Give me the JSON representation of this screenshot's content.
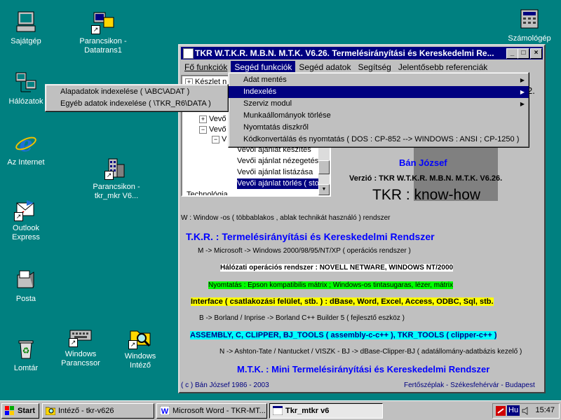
{
  "desktop": {
    "icons": [
      {
        "label": "Sajátgép"
      },
      {
        "label": "Parancsikon -\nDatatrans1"
      },
      {
        "label": "Számológép"
      },
      {
        "label": "Hálózatok"
      },
      {
        "label": "Az Internet"
      },
      {
        "label": "Parancsikon -\ntkr_mkr V6..."
      },
      {
        "label": "Outlook\nExpress"
      },
      {
        "label": "Posta"
      },
      {
        "label": "Lomtár"
      },
      {
        "label": "Windows\nParancssor"
      },
      {
        "label": "Windows\nIntéző"
      }
    ]
  },
  "window": {
    "title": "TKR W.T.K.R. M.B.N. M.T.K. V6.26.  Termelésirányítási és Kereskedelmi Re...",
    "controls": {
      "min": "_",
      "max": "□",
      "close": "×"
    },
    "menu": [
      "Fő funkciók",
      "Segéd funkciók",
      "Segéd adatok",
      "Segítség",
      "Jelentősebb referenciák"
    ],
    "tree": {
      "rows": [
        {
          "pm": "+",
          "label": "Készlet n"
        },
        {
          "pm": "",
          "label": "Vevő"
        },
        {
          "pm": "+",
          "label": "Vevő"
        },
        {
          "pm": "−",
          "label": "Vevő"
        },
        {
          "pm": "−",
          "label": "V"
        },
        {
          "pm": "",
          "label": "Vevői ajánlat készítés"
        },
        {
          "pm": "",
          "label": "Vevői ajánlat nézegetés,"
        },
        {
          "pm": "",
          "label": "Vevői ajánlat listázása"
        },
        {
          "pm": "",
          "label": "Vevői ajánlat törlés ( storn"
        },
        {
          "pm": "",
          "label": "Technológia"
        }
      ]
    },
    "partial_text_2": "2.",
    "author_name": "Bán József",
    "version": "Verzió :  TKR W.T.K.R. M.B.N. M.T.K. V6.26.",
    "big_title": "TKR :  know-how",
    "line_w": "W : Window -os ( többablakos , ablak technikát használó ) rendszer",
    "tkr_heading": "T.K.R. : Termelésirányítási és Kereskedelmi Rendszer",
    "line_m": "M -> Microsoft -> Windows 2000/98/95/NT/XP       ( operációs rendszer )",
    "network": "Hálózati operációs rendszer : NOVELL NETWARE, WINDOWS NT/2000",
    "printing": "Nyomtatás : Epson kompatibilis mátrix ;  Windows-os tintasugaras, lézer, mátrix",
    "interface": "Interface ( csatlakozási felület, stb. )  : dBase, Word, Excel, Access, ODBC, Sql, stb.",
    "line_b": "B -> Borland / Inprise -> Borland C++ Builder 5        ( fejlesztő eszköz )",
    "tools": "ASSEMBLY, C, CLIPPER, BJ_TOOLS ( assembly-c-c++ ), TKR_TOOLS ( clipper-c++ )",
    "line_n": "N -> Ashton-Tate / Nantucket / VISZK - BJ -> dBase-Clipper-BJ   ( adatállomány-adatbázis kezelő )",
    "mtk_heading": "M.T.K. : Mini Termelésirányítási és Kereskedelmi Rendszer",
    "footer_left": "( c ) Bán József 1986 - 2003",
    "footer_right": "Fertőszéplak - Székesfehérvár - Budapest"
  },
  "menus": {
    "seged": [
      {
        "label": "Adat mentés",
        "arrow": true
      },
      {
        "label": "Indexelés",
        "arrow": true,
        "highlighted": true
      },
      {
        "label": "Szerviz modul",
        "arrow": true
      },
      {
        "label": "Munkaállományok törlése",
        "arrow": false
      },
      {
        "label": "Nyomtatás diszkről",
        "arrow": false
      },
      {
        "label": "Kódkonvertálás és nyomtatás  ( DOS : CP-852 --> WINDOWS : ANSI ; CP-1250 )",
        "arrow": false
      }
    ],
    "indexeles": [
      {
        "label": "Alapadatok indexelése ( \\ABC\\ADAT )"
      },
      {
        "label": "Egyéb adatok indexelése ( \\TKR_R6\\DATA )"
      }
    ]
  },
  "taskbar": {
    "start": "Start",
    "buttons": [
      {
        "label": "Intéző - tkr-v626"
      },
      {
        "label": "Microsoft Word - TKR-MT..."
      },
      {
        "label": "Tkr_mtkr v6"
      }
    ],
    "language": "Hu",
    "clock": "15:47"
  },
  "colors": {
    "desktop": "#008080",
    "title_bar": "#000080",
    "heading_blue": "#0000ff",
    "network_bg": "#ffffff",
    "printing_bg": "#00ff00",
    "interface_bg": "#ffff00",
    "tools_bg": "#00ffff",
    "big_title": "#000000"
  }
}
